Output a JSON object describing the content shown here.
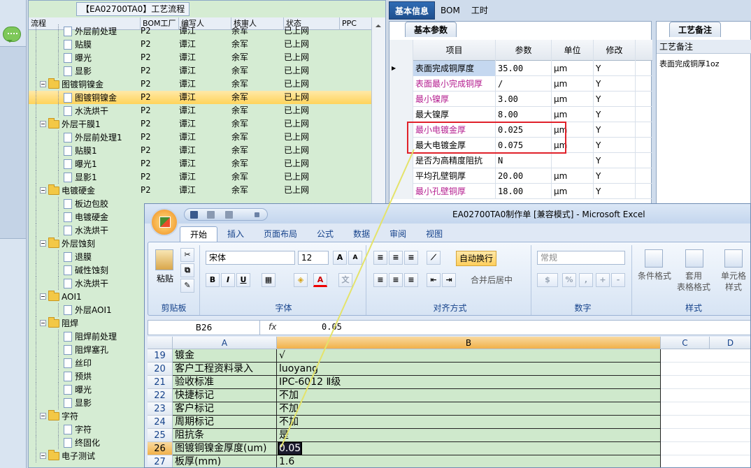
{
  "tree": {
    "title": "【EA02700TA0】工艺流程",
    "columns": [
      "流程",
      "BOM工厂",
      "编写人",
      "核审人",
      "状态",
      "PPC"
    ],
    "rows": [
      {
        "name": "外层前处理",
        "type": "doc",
        "bom": "P2",
        "writer": "谭江",
        "reviewer": "余军",
        "status": "已上网"
      },
      {
        "name": "贴膜",
        "type": "doc",
        "bom": "P2",
        "writer": "谭江",
        "reviewer": "余军",
        "status": "已上网"
      },
      {
        "name": "曝光",
        "type": "doc",
        "bom": "P2",
        "writer": "谭江",
        "reviewer": "余军",
        "status": "已上网"
      },
      {
        "name": "显影",
        "type": "doc",
        "bom": "P2",
        "writer": "谭江",
        "reviewer": "余军",
        "status": "已上网"
      },
      {
        "name": "图镀铜镍金",
        "type": "folder",
        "bom": "P2",
        "writer": "谭江",
        "reviewer": "余军",
        "status": "已上网"
      },
      {
        "name": "图镀铜镍金",
        "type": "doc",
        "bom": "P2",
        "writer": "谭江",
        "reviewer": "余军",
        "status": "已上网",
        "selected": true
      },
      {
        "name": "水洗烘干",
        "type": "doc",
        "bom": "P2",
        "writer": "谭江",
        "reviewer": "余军",
        "status": "已上网"
      },
      {
        "name": "外层干膜1",
        "type": "folder",
        "bom": "P2",
        "writer": "谭江",
        "reviewer": "余军",
        "status": "已上网"
      },
      {
        "name": "外层前处理1",
        "type": "doc",
        "bom": "P2",
        "writer": "谭江",
        "reviewer": "余军",
        "status": "已上网"
      },
      {
        "name": "贴膜1",
        "type": "doc",
        "bom": "P2",
        "writer": "谭江",
        "reviewer": "余军",
        "status": "已上网"
      },
      {
        "name": "曝光1",
        "type": "doc",
        "bom": "P2",
        "writer": "谭江",
        "reviewer": "余军",
        "status": "已上网"
      },
      {
        "name": "显影1",
        "type": "doc",
        "bom": "P2",
        "writer": "谭江",
        "reviewer": "余军",
        "status": "已上网"
      },
      {
        "name": "电镀硬金",
        "type": "folder",
        "bom": "P2",
        "writer": "谭江",
        "reviewer": "余军",
        "status": "已上网"
      },
      {
        "name": "板边包胶",
        "type": "doc",
        "bom": "",
        "writer": "",
        "reviewer": "",
        "status": ""
      },
      {
        "name": "电镀硬金",
        "type": "doc",
        "bom": "",
        "writer": "",
        "reviewer": "",
        "status": ""
      },
      {
        "name": "水洗烘干",
        "type": "doc",
        "bom": "",
        "writer": "",
        "reviewer": "",
        "status": ""
      },
      {
        "name": "外层蚀刻",
        "type": "folder",
        "bom": "",
        "writer": "",
        "reviewer": "",
        "status": ""
      },
      {
        "name": "退膜",
        "type": "doc",
        "bom": "",
        "writer": "",
        "reviewer": "",
        "status": ""
      },
      {
        "name": "碱性蚀刻",
        "type": "doc",
        "bom": "",
        "writer": "",
        "reviewer": "",
        "status": ""
      },
      {
        "name": "水洗烘干",
        "type": "doc",
        "bom": "",
        "writer": "",
        "reviewer": "",
        "status": ""
      },
      {
        "name": "AOI1",
        "type": "folder",
        "bom": "",
        "writer": "",
        "reviewer": "",
        "status": ""
      },
      {
        "name": "外层AOI1",
        "type": "doc",
        "bom": "",
        "writer": "",
        "reviewer": "",
        "status": ""
      },
      {
        "name": "阻焊",
        "type": "folder",
        "bom": "",
        "writer": "",
        "reviewer": "",
        "status": ""
      },
      {
        "name": "阻焊前处理",
        "type": "doc",
        "bom": "",
        "writer": "",
        "reviewer": "",
        "status": ""
      },
      {
        "name": "阻焊塞孔",
        "type": "doc",
        "bom": "",
        "writer": "",
        "reviewer": "",
        "status": ""
      },
      {
        "name": "丝印",
        "type": "doc",
        "bom": "",
        "writer": "",
        "reviewer": "",
        "status": ""
      },
      {
        "name": "预烘",
        "type": "doc",
        "bom": "",
        "writer": "",
        "reviewer": "",
        "status": ""
      },
      {
        "name": "曝光",
        "type": "doc",
        "bom": "",
        "writer": "",
        "reviewer": "",
        "status": ""
      },
      {
        "name": "显影",
        "type": "doc",
        "bom": "",
        "writer": "",
        "reviewer": "",
        "status": ""
      },
      {
        "name": "字符",
        "type": "folder",
        "bom": "",
        "writer": "",
        "reviewer": "",
        "status": ""
      },
      {
        "name": "字符",
        "type": "doc",
        "bom": "",
        "writer": "",
        "reviewer": "",
        "status": ""
      },
      {
        "name": "终固化",
        "type": "doc",
        "bom": "",
        "writer": "",
        "reviewer": "",
        "status": ""
      },
      {
        "name": "电子测试",
        "type": "folder",
        "bom": "",
        "writer": "",
        "reviewer": "",
        "status": ""
      }
    ]
  },
  "right_tabs": [
    "基本信息",
    "BOM",
    "工时"
  ],
  "basic_params": {
    "tab": "基本参数",
    "headers": [
      "项目",
      "参数",
      "单位",
      "修改"
    ],
    "rows": [
      {
        "item": "表面完成铜厚度",
        "value": "35.00",
        "unit": "μm",
        "mod": "Y",
        "color": "normal",
        "current": true
      },
      {
        "item": "表面最小完成铜厚",
        "value": "/",
        "unit": "μm",
        "mod": "Y",
        "color": "pink"
      },
      {
        "item": "最小镍厚",
        "value": "3.00",
        "unit": "μm",
        "mod": "Y",
        "color": "pink"
      },
      {
        "item": "最大镍厚",
        "value": "8.00",
        "unit": "μm",
        "mod": "Y",
        "color": "normal"
      },
      {
        "item": "最小电镀金厚",
        "value": "0.025",
        "unit": "μm",
        "mod": "Y",
        "color": "pink"
      },
      {
        "item": "最大电镀金厚",
        "value": "0.075",
        "unit": "μm",
        "mod": "Y",
        "color": "normal"
      },
      {
        "item": "是否为高精度阻抗",
        "value": "N",
        "unit": "",
        "mod": "Y",
        "color": "normal"
      },
      {
        "item": "平均孔壁铜厚",
        "value": "20.00",
        "unit": "μm",
        "mod": "Y",
        "color": "normal"
      },
      {
        "item": "最小孔壁铜厚",
        "value": "18.00",
        "unit": "μm",
        "mod": "Y",
        "color": "pink"
      }
    ]
  },
  "remark": {
    "tab": "工艺备注",
    "header": "工艺备注",
    "value": "表面完成铜厚1oz"
  },
  "excel": {
    "title": "EA02700TA0制作单 [兼容模式] - Microsoft Excel",
    "ribbon_tabs": [
      "开始",
      "插入",
      "页面布局",
      "公式",
      "数据",
      "审阅",
      "视图"
    ],
    "clipboard": {
      "paste": "粘贴",
      "label": "剪贴板"
    },
    "font": {
      "name": "宋体",
      "size": "12",
      "label": "字体",
      "bold": "B",
      "italic": "I",
      "underline": "U",
      "grow": "A",
      "shrink": "A"
    },
    "align": {
      "wrap": "自动换行",
      "merge": "合并后居中",
      "label": "对齐方式"
    },
    "number": {
      "format": "常规",
      "percent": "%",
      "label": "数字"
    },
    "styles": {
      "cond": "条件格式",
      "table1": "套用",
      "table2": "表格格式",
      "cell1": "单元格",
      "cell2": "样式",
      "label": "样式"
    },
    "namebox": "B26",
    "fx": "fx",
    "formula": "0.05",
    "columns": [
      "A",
      "B",
      "C",
      "D"
    ],
    "rows": [
      {
        "n": "19",
        "a": "镀金",
        "b": "√"
      },
      {
        "n": "20",
        "a": "客户工程资料录入",
        "b": "luoyang"
      },
      {
        "n": "21",
        "a": "验收标准",
        "b": "IPC-6012 Ⅱ级"
      },
      {
        "n": "22",
        "a": "快捷标记",
        "b": "不加"
      },
      {
        "n": "23",
        "a": "客户标记",
        "b": "不加"
      },
      {
        "n": "24",
        "a": "周期标记",
        "b": "不加"
      },
      {
        "n": "25",
        "a": "阻抗条",
        "b": "是"
      },
      {
        "n": "26",
        "a": "图镀铜镍金厚度(um)",
        "b": "0.05",
        "active": true
      },
      {
        "n": "27",
        "a": "板厚(mm)",
        "b": "1.6"
      }
    ]
  }
}
